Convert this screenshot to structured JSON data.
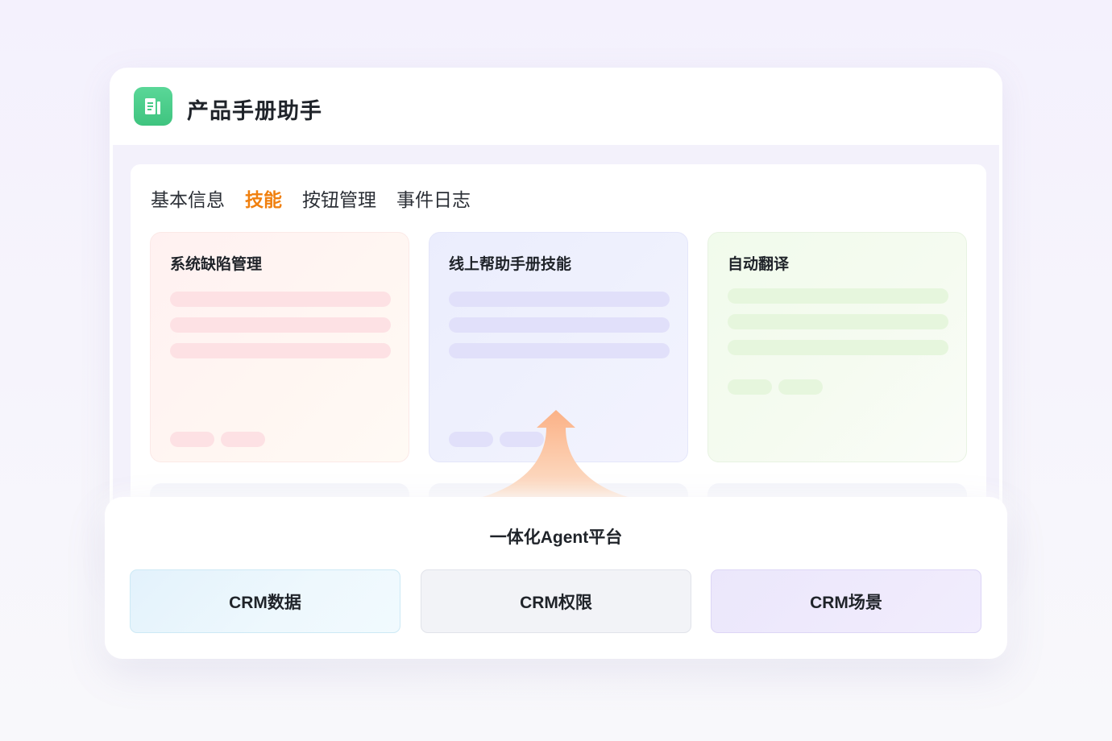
{
  "app": {
    "title": "产品手册助手"
  },
  "tabs": [
    {
      "label": "基本信息",
      "active": false
    },
    {
      "label": "技能",
      "active": true
    },
    {
      "label": "按钮管理",
      "active": false
    },
    {
      "label": "事件日志",
      "active": false
    }
  ],
  "skills": [
    {
      "title": "系统缺陷管理"
    },
    {
      "title": "线上帮助手册技能"
    },
    {
      "title": "自动翻译"
    }
  ],
  "platform": {
    "title": "一体化Agent平台",
    "items": [
      "CRM数据",
      "CRM权限",
      "CRM场景"
    ]
  },
  "colors": {
    "accent_tab": "#f0800f",
    "app_icon": "#3fc47f",
    "arrow": "#fbb98c"
  },
  "icons": {
    "app": "document-icon",
    "arrow": "up-arrow-icon"
  }
}
